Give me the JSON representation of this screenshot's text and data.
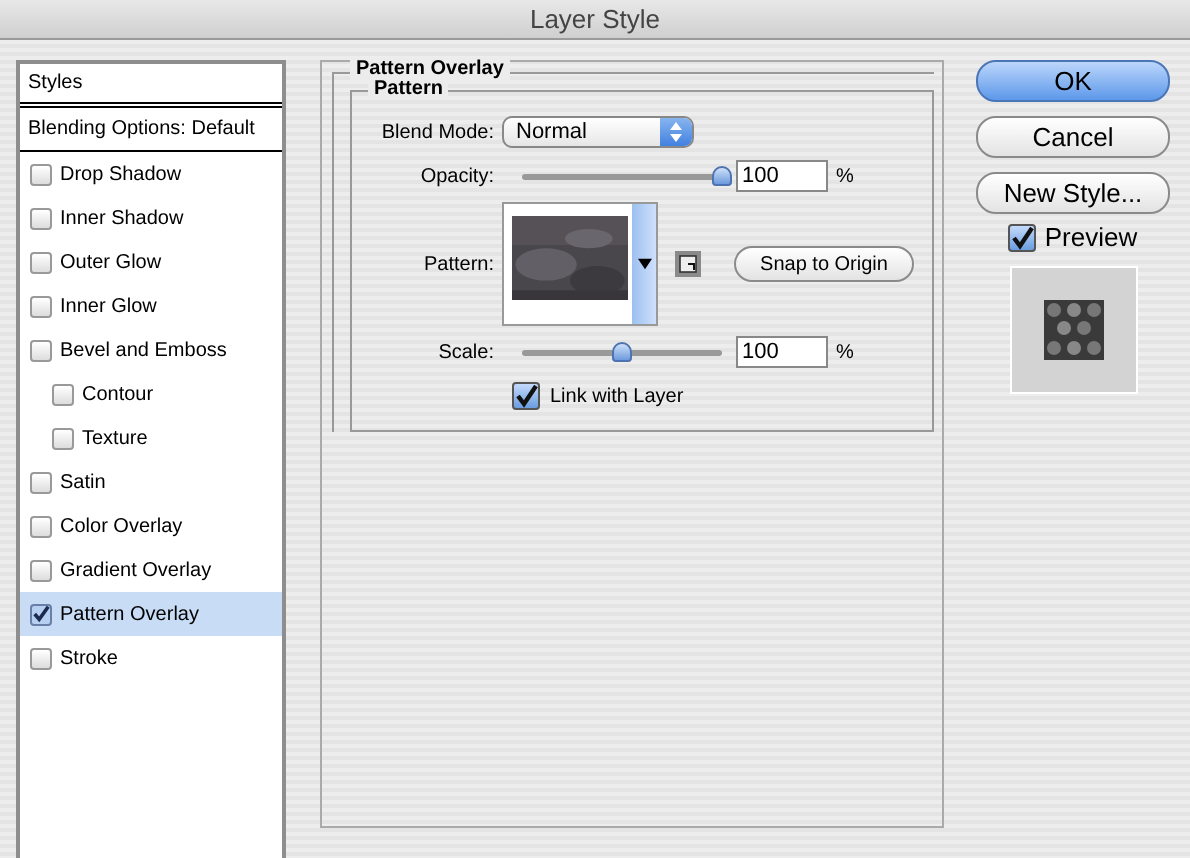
{
  "window": {
    "title": "Layer Style"
  },
  "sidebar": {
    "header": "Styles",
    "blending": "Blending Options: Default",
    "items": [
      {
        "label": "Drop Shadow",
        "checked": false,
        "selected": false
      },
      {
        "label": "Inner Shadow",
        "checked": false,
        "selected": false
      },
      {
        "label": "Outer Glow",
        "checked": false,
        "selected": false
      },
      {
        "label": "Inner Glow",
        "checked": false,
        "selected": false
      },
      {
        "label": "Bevel and Emboss",
        "checked": false,
        "selected": false,
        "children": [
          {
            "label": "Contour",
            "checked": false,
            "selected": false
          },
          {
            "label": "Texture",
            "checked": false,
            "selected": false
          }
        ]
      },
      {
        "label": "Satin",
        "checked": false,
        "selected": false
      },
      {
        "label": "Color Overlay",
        "checked": false,
        "selected": false
      },
      {
        "label": "Gradient Overlay",
        "checked": false,
        "selected": false
      },
      {
        "label": "Pattern Overlay",
        "checked": true,
        "selected": true
      },
      {
        "label": "Stroke",
        "checked": false,
        "selected": false
      }
    ]
  },
  "panel": {
    "title": "Pattern Overlay",
    "section": "Pattern",
    "blend_mode": {
      "label": "Blend Mode:",
      "value": "Normal"
    },
    "opacity": {
      "label": "Opacity:",
      "level": 1.0,
      "value": "100",
      "unit": "%"
    },
    "pattern": {
      "label": "Pattern:",
      "button": "Snap to Origin"
    },
    "scale": {
      "label": "Scale:",
      "level": 0.5,
      "value": "100",
      "unit": "%"
    },
    "link_with_layer": {
      "label": "Link with Layer",
      "checked": true
    }
  },
  "buttons": [
    {
      "label": "OK",
      "default": true
    },
    {
      "label": "Cancel",
      "default": false
    },
    {
      "label": "New Style...",
      "default": false
    }
  ],
  "preview": {
    "label": "Preview",
    "checked": true
  }
}
